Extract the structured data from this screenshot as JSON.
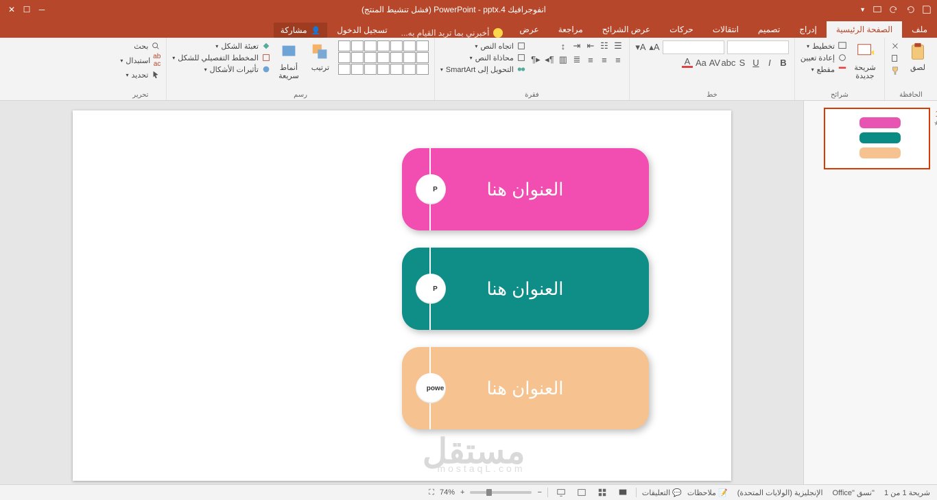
{
  "titlebar": {
    "title": "انفوجرافيك PowerPoint - pptx.4 (فشل تنشيط المنتج)"
  },
  "tabs": {
    "file": "ملف",
    "home": "الصفحة الرئيسية",
    "insert": "إدراج",
    "design": "تصميم",
    "transitions": "انتقالات",
    "animations": "حركات",
    "slideshow": "عرض الشرائح",
    "review": "مراجعة",
    "view": "عرض",
    "tellme": "أخبرني بما تربد القيام به...",
    "signin": "تسجيل الدخول",
    "share": "مشاركة"
  },
  "ribbon": {
    "clipboard": {
      "label": "الحافظة",
      "paste": "لصق"
    },
    "slides": {
      "label": "شرائح",
      "new_slide": "شريحة\nجديدة",
      "layout": "تخطيط",
      "reset": "إعادة تعيين",
      "section": "مقطع"
    },
    "font": {
      "label": "خط",
      "size": ""
    },
    "paragraph": {
      "label": "فقرة",
      "direction": "اتجاه النص",
      "align": "محاذاة النص",
      "smartart": "التحويل إلى SmartArt"
    },
    "drawing": {
      "label": "رسم",
      "arrange": "ترتيب",
      "quick": "أنماط\nسريعة",
      "shape_fill": "تعبئة الشكل",
      "shape_outline": "المخطط التفصيلي للشكل",
      "shape_effects": "تأثيرات الأشكال"
    },
    "editing": {
      "label": "تحرير",
      "find": "بحث",
      "replace": "استبدال",
      "select": "تحديد"
    }
  },
  "thumbs": {
    "slide1_num": "1"
  },
  "slide": {
    "titles": [
      "العنوان هنا",
      "العنوان هنا",
      "العنوان هنا"
    ],
    "knobs": [
      "P",
      "P",
      "powe"
    ],
    "watermark": "مستقل",
    "watermark_sub": "mostaqL.com"
  },
  "status": {
    "slide_info": "شريحة 1 من 1",
    "format": "\"نسق \"Office",
    "language": "الإنجليزية (الولايات المتحدة)",
    "notes": "ملاحظات",
    "comments": "التعليقات",
    "zoom": "74%"
  }
}
